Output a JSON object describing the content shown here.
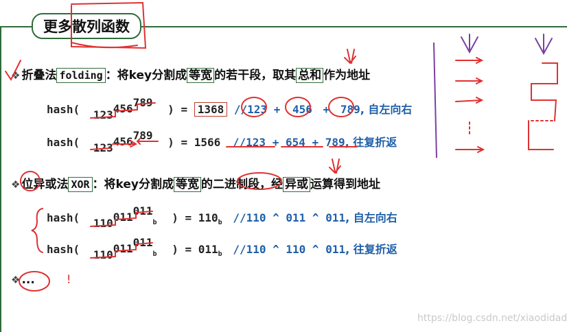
{
  "title": "更多散列函数",
  "folding": {
    "label": "折叠法",
    "keyword": "folding",
    "desc_pre": "：将key分割成",
    "equal_width": "等宽",
    "desc_mid": "的若干段，取其",
    "sum": "总和",
    "desc_post": "作为地址",
    "ex1": {
      "fn": "hash(",
      "seg1": "123",
      "seg2": "456",
      "seg3": "789",
      "close": ") =",
      "result": "1368",
      "expr_prefix": "//",
      "t1": "123",
      "op1": "+",
      "t2": "456",
      "op2": "+",
      "t3": "789",
      "note": ", 自左向右"
    },
    "ex2": {
      "fn": "hash(",
      "seg1": "123",
      "seg2": "456",
      "seg3": "789",
      "close": ") =",
      "result": "1566",
      "expr": "//123 + 654 + 789",
      "note": ", 往复折返"
    }
  },
  "xor": {
    "label": "位异或法",
    "keyword": "XOR",
    "desc_pre": "：将key分割成",
    "equal_width": "等宽",
    "desc_mid": "的",
    "binary": "二进制",
    "desc_mid2": "段，经",
    "xor_word": "异或",
    "desc_post": "运算得到地址",
    "ex1": {
      "fn": "hash(",
      "seg1": "110",
      "seg2": "011",
      "seg3": "011",
      "subscript": "b",
      "close": ") =",
      "result": "110",
      "result_sub": "b",
      "expr": "//110 ^ 011 ^ 011",
      "note": ", 自左向右"
    },
    "ex2": {
      "fn": "hash(",
      "seg1": "110",
      "seg2": "011",
      "seg3": "011",
      "subscript": "b",
      "close": ") =",
      "result": "011",
      "result_sub": "b",
      "expr": "//110 ^ 110 ^ 011",
      "note": ", 往复折返"
    }
  },
  "more": "...",
  "more_mark": "!",
  "watermark": "https://blog.csdn.net/xiaodidadada",
  "colors": {
    "frame": "#2f6b3a",
    "annotation_red": "#e03030",
    "annotation_purple": "#7b3fa0",
    "expr_blue": "#1f5fa8"
  }
}
